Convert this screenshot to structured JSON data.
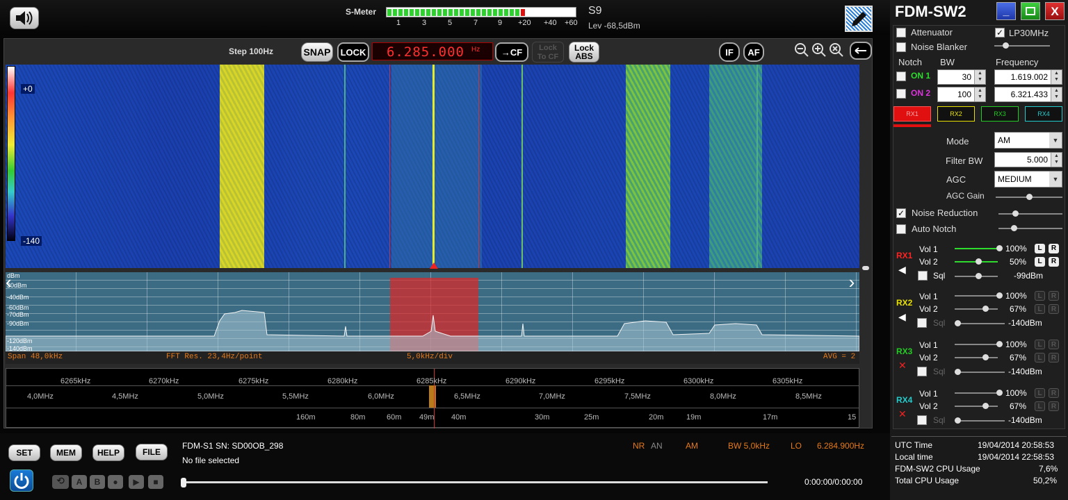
{
  "app": {
    "title": "FDM-SW2"
  },
  "smeter": {
    "label": "S-Meter",
    "scale": [
      "1",
      "3",
      "5",
      "7",
      "9",
      "+20",
      "+40",
      "+60"
    ],
    "reading": "S9",
    "level": "Lev -68,5dBm",
    "fill_fraction": 0.73
  },
  "toolbar": {
    "step": "Step 100Hz",
    "snap": "SNAP",
    "lock": "LOCK",
    "frequency": "6.285.000",
    "freq_unit": "Hz",
    "to_cf": "→CF",
    "lock_to_cf_1": "Lock",
    "lock_to_cf_2": "To CF",
    "lock_abs_1": "Lock",
    "lock_abs_2": "ABS",
    "if": "IF",
    "af": "AF"
  },
  "waterfall": {
    "top_level": "+0",
    "bottom_level": "-140"
  },
  "spectrum": {
    "db_labels": [
      "dBm",
      "30dBm",
      "-40dBm",
      "-60dBm",
      "-70dBm",
      "-90dBm",
      "-120dBm",
      "-140dBm"
    ]
  },
  "status": {
    "span": "Span 48,0kHz",
    "fft": "FFT Res. 23,4Hz/point",
    "div": "5,0kHz/div",
    "avg": "AVG = 2"
  },
  "scale": {
    "khz": [
      "6265kHz",
      "6270kHz",
      "6275kHz",
      "6280kHz",
      "6285kHz",
      "6290kHz",
      "6295kHz",
      "6300kHz",
      "6305kHz"
    ],
    "mhz": [
      "4,0MHz",
      "4,5MHz",
      "5,0MHz",
      "5,5MHz",
      "6,0MHz",
      "6,5MHz",
      "7,0MHz",
      "7,5MHz",
      "8,0MHz",
      "8,5MHz"
    ],
    "bands": [
      "160m",
      "80m",
      "60m",
      "49m",
      "40m",
      "30m",
      "25m",
      "20m",
      "19m",
      "17m",
      "15"
    ]
  },
  "buttons": {
    "set": "SET",
    "mem": "MEM",
    "help": "HELP",
    "file": "FILE"
  },
  "device": {
    "serial": "FDM-S1 SN: SD00OB_298",
    "file": "No file selected",
    "nr": "NR",
    "an": "AN",
    "mode": "AM",
    "bw": "BW 5,0kHz",
    "lo": "LO",
    "lo_value": "6.284.900Hz",
    "time": "0:00:00/0:00:00"
  },
  "panel": {
    "attenuator": "Attenuator",
    "noise_blanker": "Noise Blanker",
    "lp30": "LP30MHz",
    "notch": "Notch",
    "bw": "BW",
    "frequency": "Frequency",
    "on1": "ON 1",
    "on2": "ON 2",
    "bw1": "30",
    "bw2": "100",
    "freq1": "1.619.002",
    "freq2": "6.321.433",
    "rx": [
      "RX1",
      "RX2",
      "RX3",
      "RX4"
    ],
    "mode_label": "Mode",
    "mode_value": "AM",
    "filter_label": "Filter BW",
    "filter_value": "5.000",
    "agc_label": "AGC",
    "agc_value": "MEDIUM",
    "agc_gain": "AGC Gain",
    "noise_reduction": "Noise Reduction",
    "auto_notch": "Auto Notch"
  },
  "receivers": [
    {
      "name": "RX1",
      "color": "#ff2222",
      "vol1": "100%",
      "vol2": "50%",
      "sql": "-99dBm"
    },
    {
      "name": "RX2",
      "color": "#e8e000",
      "vol1": "100%",
      "vol2": "67%",
      "sql": "-140dBm"
    },
    {
      "name": "RX3",
      "color": "#22cc22",
      "vol1": "100%",
      "vol2": "67%",
      "sql": "-140dBm"
    },
    {
      "name": "RX4",
      "color": "#22cccc",
      "vol1": "100%",
      "vol2": "67%",
      "sql": "-140dBm"
    }
  ],
  "labels": {
    "vol1": "Vol 1",
    "vol2": "Vol 2",
    "sql": "Sql",
    "l": "L",
    "r": "R"
  },
  "info": {
    "utc_label": "UTC Time",
    "utc": "19/04/2014 20:58:53",
    "local_label": "Local time",
    "local": "19/04/2014 22:58:53",
    "cpu_label": "FDM-SW2 CPU Usage",
    "cpu": "7,6%",
    "total_label": "Total CPU Usage",
    "total": "50,2%"
  }
}
